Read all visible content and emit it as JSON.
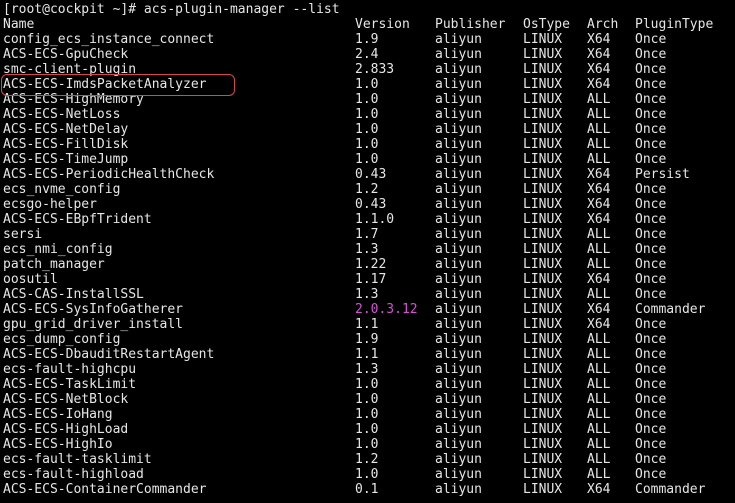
{
  "terminal": {
    "command_line": "[root@cockpit ~]# acs-plugin-manager --list",
    "header": {
      "name": "Name",
      "version": "Version",
      "publisher": "Publisher",
      "ostype": "OsType",
      "arch": "Arch",
      "plugintype": "PluginType"
    },
    "rows": [
      {
        "name": "config_ecs_instance_connect",
        "version": "1.9",
        "publisher": "aliyun",
        "ostype": "LINUX",
        "arch": "X64",
        "plugintype": "Once"
      },
      {
        "name": "ACS-ECS-GpuCheck",
        "version": "2.4",
        "publisher": "aliyun",
        "ostype": "LINUX",
        "arch": "X64",
        "plugintype": "Once"
      },
      {
        "name": "smc-client-plugin",
        "version": "2.833",
        "publisher": "aliyun",
        "ostype": "LINUX",
        "arch": "X64",
        "plugintype": "Once"
      },
      {
        "name": "ACS-ECS-ImdsPacketAnalyzer",
        "version": "1.0",
        "publisher": "aliyun",
        "ostype": "LINUX",
        "arch": "X64",
        "plugintype": "Once"
      },
      {
        "name": "ACS-ECS-HighMemory",
        "version": "1.0",
        "publisher": "aliyun",
        "ostype": "LINUX",
        "arch": "ALL",
        "plugintype": "Once"
      },
      {
        "name": "ACS-ECS-NetLoss",
        "version": "1.0",
        "publisher": "aliyun",
        "ostype": "LINUX",
        "arch": "ALL",
        "plugintype": "Once"
      },
      {
        "name": "ACS-ECS-NetDelay",
        "version": "1.0",
        "publisher": "aliyun",
        "ostype": "LINUX",
        "arch": "ALL",
        "plugintype": "Once"
      },
      {
        "name": "ACS-ECS-FillDisk",
        "version": "1.0",
        "publisher": "aliyun",
        "ostype": "LINUX",
        "arch": "ALL",
        "plugintype": "Once"
      },
      {
        "name": "ACS-ECS-TimeJump",
        "version": "1.0",
        "publisher": "aliyun",
        "ostype": "LINUX",
        "arch": "ALL",
        "plugintype": "Once"
      },
      {
        "name": "ACS-ECS-PeriodicHealthCheck",
        "version": "0.43",
        "publisher": "aliyun",
        "ostype": "LINUX",
        "arch": "X64",
        "plugintype": "Persist"
      },
      {
        "name": "ecs_nvme_config",
        "version": "1.2",
        "publisher": "aliyun",
        "ostype": "LINUX",
        "arch": "X64",
        "plugintype": "Once"
      },
      {
        "name": "ecsgo-helper",
        "version": "0.43",
        "publisher": "aliyun",
        "ostype": "LINUX",
        "arch": "X64",
        "plugintype": "Once"
      },
      {
        "name": "ACS-ECS-EBpfTrident",
        "version": "1.1.0",
        "publisher": "aliyun",
        "ostype": "LINUX",
        "arch": "X64",
        "plugintype": "Once"
      },
      {
        "name": "sersi",
        "version": "1.7",
        "publisher": "aliyun",
        "ostype": "LINUX",
        "arch": "ALL",
        "plugintype": "Once"
      },
      {
        "name": "ecs_nmi_config",
        "version": "1.3",
        "publisher": "aliyun",
        "ostype": "LINUX",
        "arch": "ALL",
        "plugintype": "Once"
      },
      {
        "name": "patch_manager",
        "version": "1.22",
        "publisher": "aliyun",
        "ostype": "LINUX",
        "arch": "ALL",
        "plugintype": "Once"
      },
      {
        "name": "oosutil",
        "version": "1.17",
        "publisher": "aliyun",
        "ostype": "LINUX",
        "arch": "X64",
        "plugintype": "Once"
      },
      {
        "name": "ACS-CAS-InstallSSL",
        "version": "1.3",
        "publisher": "aliyun",
        "ostype": "LINUX",
        "arch": "ALL",
        "plugintype": "Once"
      },
      {
        "name": "ACS-ECS-SysInfoGatherer",
        "version": "2.0.3.12",
        "publisher": "aliyun",
        "ostype": "LINUX",
        "arch": "X64",
        "plugintype": "Commander"
      },
      {
        "name": "gpu_grid_driver_install",
        "version": "1.1",
        "publisher": "aliyun",
        "ostype": "LINUX",
        "arch": "X64",
        "plugintype": "Once"
      },
      {
        "name": "ecs_dump_config",
        "version": "1.9",
        "publisher": "aliyun",
        "ostype": "LINUX",
        "arch": "ALL",
        "plugintype": "Once"
      },
      {
        "name": "ACS-ECS-DbauditRestartAgent",
        "version": "1.1",
        "publisher": "aliyun",
        "ostype": "LINUX",
        "arch": "ALL",
        "plugintype": "Once"
      },
      {
        "name": "ecs-fault-highcpu",
        "version": "1.3",
        "publisher": "aliyun",
        "ostype": "LINUX",
        "arch": "ALL",
        "plugintype": "Once"
      },
      {
        "name": "ACS-ECS-TaskLimit",
        "version": "1.0",
        "publisher": "aliyun",
        "ostype": "LINUX",
        "arch": "ALL",
        "plugintype": "Once"
      },
      {
        "name": "ACS-ECS-NetBlock",
        "version": "1.0",
        "publisher": "aliyun",
        "ostype": "LINUX",
        "arch": "ALL",
        "plugintype": "Once"
      },
      {
        "name": "ACS-ECS-IoHang",
        "version": "1.0",
        "publisher": "aliyun",
        "ostype": "LINUX",
        "arch": "ALL",
        "plugintype": "Once"
      },
      {
        "name": "ACS-ECS-HighLoad",
        "version": "1.0",
        "publisher": "aliyun",
        "ostype": "LINUX",
        "arch": "ALL",
        "plugintype": "Once"
      },
      {
        "name": "ACS-ECS-HighIo",
        "version": "1.0",
        "publisher": "aliyun",
        "ostype": "LINUX",
        "arch": "ALL",
        "plugintype": "Once"
      },
      {
        "name": "ecs-fault-tasklimit",
        "version": "1.2",
        "publisher": "aliyun",
        "ostype": "LINUX",
        "arch": "ALL",
        "plugintype": "Once"
      },
      {
        "name": "ecs-fault-highload",
        "version": "1.0",
        "publisher": "aliyun",
        "ostype": "LINUX",
        "arch": "ALL",
        "plugintype": "Once"
      },
      {
        "name": "ACS-ECS-ContainerCommander",
        "version": "0.1",
        "publisher": "aliyun",
        "ostype": "LINUX",
        "arch": "X64",
        "plugintype": "Commander"
      }
    ],
    "highlighted_row_index": 3,
    "highlighted_version_row_index": 18,
    "colors": {
      "background": "#000000",
      "text": "#e6e6e6",
      "highlight_border": "#d8484a",
      "version_highlight": "#d64fd6"
    }
  }
}
